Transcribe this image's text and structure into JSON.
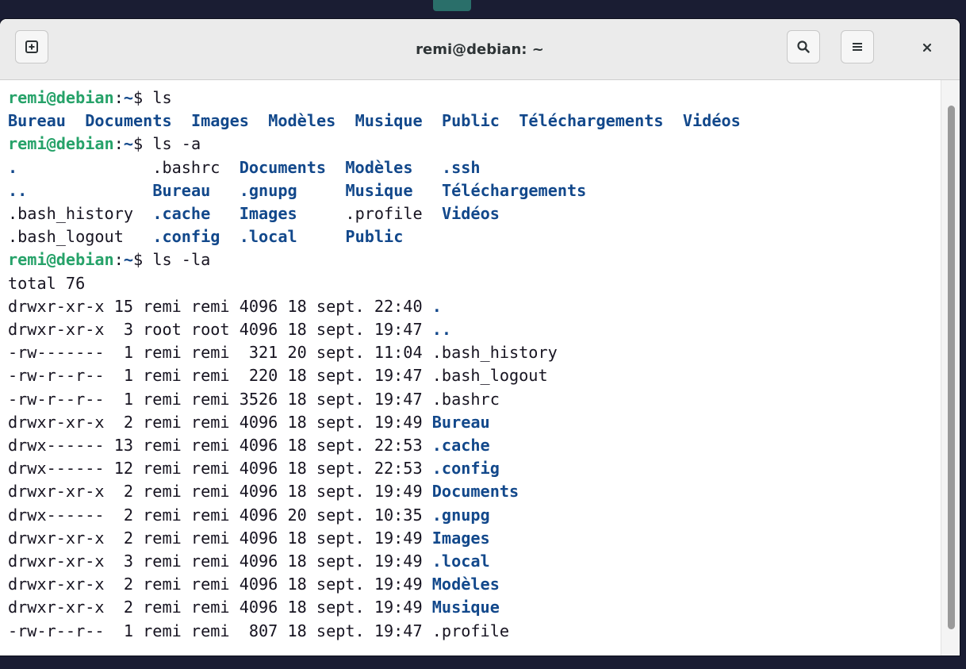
{
  "window": {
    "title": "remi@debian: ~"
  },
  "icons": {
    "new_tab": "new-tab-icon",
    "search": "search-icon",
    "menu": "hamburger-menu-icon",
    "close": "close-icon"
  },
  "colors": {
    "prompt_user": "#26a269",
    "prompt_path": "#12488b",
    "directory": "#12488b",
    "text": "#171421",
    "titlebar": "#ebebeb"
  },
  "prompt": {
    "user": "remi@debian",
    "sep": ":",
    "path": "~",
    "dollar": "$ "
  },
  "terminal": {
    "lines": [
      [
        {
          "t": "remi@debian",
          "c": "p"
        },
        {
          "t": ":",
          "c": "n"
        },
        {
          "t": "~",
          "c": "pp"
        },
        {
          "t": "$ ls",
          "c": "n"
        }
      ],
      [
        {
          "t": "Bureau",
          "c": "d"
        },
        {
          "t": "  ",
          "c": "n"
        },
        {
          "t": "Documents",
          "c": "d"
        },
        {
          "t": "  ",
          "c": "n"
        },
        {
          "t": "Images",
          "c": "d"
        },
        {
          "t": "  ",
          "c": "n"
        },
        {
          "t": "Modèles",
          "c": "d"
        },
        {
          "t": "  ",
          "c": "n"
        },
        {
          "t": "Musique",
          "c": "d"
        },
        {
          "t": "  ",
          "c": "n"
        },
        {
          "t": "Public",
          "c": "d"
        },
        {
          "t": "  ",
          "c": "n"
        },
        {
          "t": "Téléchargements",
          "c": "d"
        },
        {
          "t": "  ",
          "c": "n"
        },
        {
          "t": "Vidéos",
          "c": "d"
        }
      ],
      [
        {
          "t": "remi@debian",
          "c": "p"
        },
        {
          "t": ":",
          "c": "n"
        },
        {
          "t": "~",
          "c": "pp"
        },
        {
          "t": "$ ls -a",
          "c": "n"
        }
      ],
      [
        {
          "t": ".",
          "c": "d"
        },
        {
          "t": "              .bashrc  ",
          "c": "n"
        },
        {
          "t": "Documents",
          "c": "d"
        },
        {
          "t": "  ",
          "c": "n"
        },
        {
          "t": "Modèles",
          "c": "d"
        },
        {
          "t": "   ",
          "c": "n"
        },
        {
          "t": ".ssh",
          "c": "d"
        }
      ],
      [
        {
          "t": "..",
          "c": "d"
        },
        {
          "t": "             ",
          "c": "n"
        },
        {
          "t": "Bureau",
          "c": "d"
        },
        {
          "t": "   ",
          "c": "n"
        },
        {
          "t": ".gnupg",
          "c": "d"
        },
        {
          "t": "     ",
          "c": "n"
        },
        {
          "t": "Musique",
          "c": "d"
        },
        {
          "t": "   ",
          "c": "n"
        },
        {
          "t": "Téléchargements",
          "c": "d"
        }
      ],
      [
        {
          "t": ".bash_history  ",
          "c": "n"
        },
        {
          "t": ".cache",
          "c": "d"
        },
        {
          "t": "   ",
          "c": "n"
        },
        {
          "t": "Images",
          "c": "d"
        },
        {
          "t": "     .profile  ",
          "c": "n"
        },
        {
          "t": "Vidéos",
          "c": "d"
        }
      ],
      [
        {
          "t": ".bash_logout   ",
          "c": "n"
        },
        {
          "t": ".config",
          "c": "d"
        },
        {
          "t": "  ",
          "c": "n"
        },
        {
          "t": ".local",
          "c": "d"
        },
        {
          "t": "     ",
          "c": "n"
        },
        {
          "t": "Public",
          "c": "d"
        }
      ],
      [
        {
          "t": "remi@debian",
          "c": "p"
        },
        {
          "t": ":",
          "c": "n"
        },
        {
          "t": "~",
          "c": "pp"
        },
        {
          "t": "$ ls -la",
          "c": "n"
        }
      ],
      [
        {
          "t": "total 76",
          "c": "n"
        }
      ],
      [
        {
          "t": "drwxr-xr-x 15 remi remi 4096 18 sept. 22:40 ",
          "c": "n"
        },
        {
          "t": ".",
          "c": "d"
        }
      ],
      [
        {
          "t": "drwxr-xr-x  3 root root 4096 18 sept. 19:47 ",
          "c": "n"
        },
        {
          "t": "..",
          "c": "d"
        }
      ],
      [
        {
          "t": "-rw-------  1 remi remi  321 20 sept. 11:04 .bash_history",
          "c": "n"
        }
      ],
      [
        {
          "t": "-rw-r--r--  1 remi remi  220 18 sept. 19:47 .bash_logout",
          "c": "n"
        }
      ],
      [
        {
          "t": "-rw-r--r--  1 remi remi 3526 18 sept. 19:47 .bashrc",
          "c": "n"
        }
      ],
      [
        {
          "t": "drwxr-xr-x  2 remi remi 4096 18 sept. 19:49 ",
          "c": "n"
        },
        {
          "t": "Bureau",
          "c": "d"
        }
      ],
      [
        {
          "t": "drwx------ 13 remi remi 4096 18 sept. 22:53 ",
          "c": "n"
        },
        {
          "t": ".cache",
          "c": "d"
        }
      ],
      [
        {
          "t": "drwx------ 12 remi remi 4096 18 sept. 22:53 ",
          "c": "n"
        },
        {
          "t": ".config",
          "c": "d"
        }
      ],
      [
        {
          "t": "drwxr-xr-x  2 remi remi 4096 18 sept. 19:49 ",
          "c": "n"
        },
        {
          "t": "Documents",
          "c": "d"
        }
      ],
      [
        {
          "t": "drwx------  2 remi remi 4096 20 sept. 10:35 ",
          "c": "n"
        },
        {
          "t": ".gnupg",
          "c": "d"
        }
      ],
      [
        {
          "t": "drwxr-xr-x  2 remi remi 4096 18 sept. 19:49 ",
          "c": "n"
        },
        {
          "t": "Images",
          "c": "d"
        }
      ],
      [
        {
          "t": "drwxr-xr-x  3 remi remi 4096 18 sept. 19:49 ",
          "c": "n"
        },
        {
          "t": ".local",
          "c": "d"
        }
      ],
      [
        {
          "t": "drwxr-xr-x  2 remi remi 4096 18 sept. 19:49 ",
          "c": "n"
        },
        {
          "t": "Modèles",
          "c": "d"
        }
      ],
      [
        {
          "t": "drwxr-xr-x  2 remi remi 4096 18 sept. 19:49 ",
          "c": "n"
        },
        {
          "t": "Musique",
          "c": "d"
        }
      ],
      [
        {
          "t": "-rw-r--r--  1 remi remi  807 18 sept. 19:47 .profile",
          "c": "n"
        }
      ]
    ]
  }
}
